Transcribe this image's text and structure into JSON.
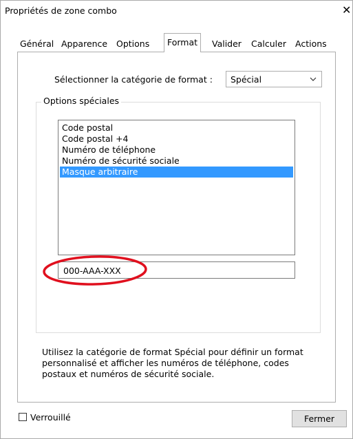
{
  "window": {
    "title": "Propriétés de zone combo",
    "close_glyph": "✕"
  },
  "tabs": [
    {
      "label": "Général"
    },
    {
      "label": "Apparence"
    },
    {
      "label": "Options"
    },
    {
      "label": "Format",
      "active": true
    },
    {
      "label": "Valider"
    },
    {
      "label": "Calculer"
    },
    {
      "label": "Actions"
    }
  ],
  "format": {
    "category_label": "Sélectionner la catégorie de format :",
    "category_value": "Spécial",
    "group_title": "Options spéciales",
    "options": [
      "Code postal",
      "Code postal +4",
      "Numéro de téléphone",
      "Numéro de sécurité sociale",
      "Masque arbitraire"
    ],
    "selected_option": "Masque arbitraire",
    "mask_value": "000-AAA-XXX",
    "help_text": "Utilisez la catégorie de format Spécial pour définir un format personnalisé et afficher les numéros de téléphone, codes postaux et numéros de sécurité sociale."
  },
  "footer": {
    "locked_label": "Verrouillé",
    "locked_checked": false,
    "close_button": "Fermer"
  },
  "colors": {
    "selection": "#3399ff",
    "annotation": "#e0101e"
  }
}
